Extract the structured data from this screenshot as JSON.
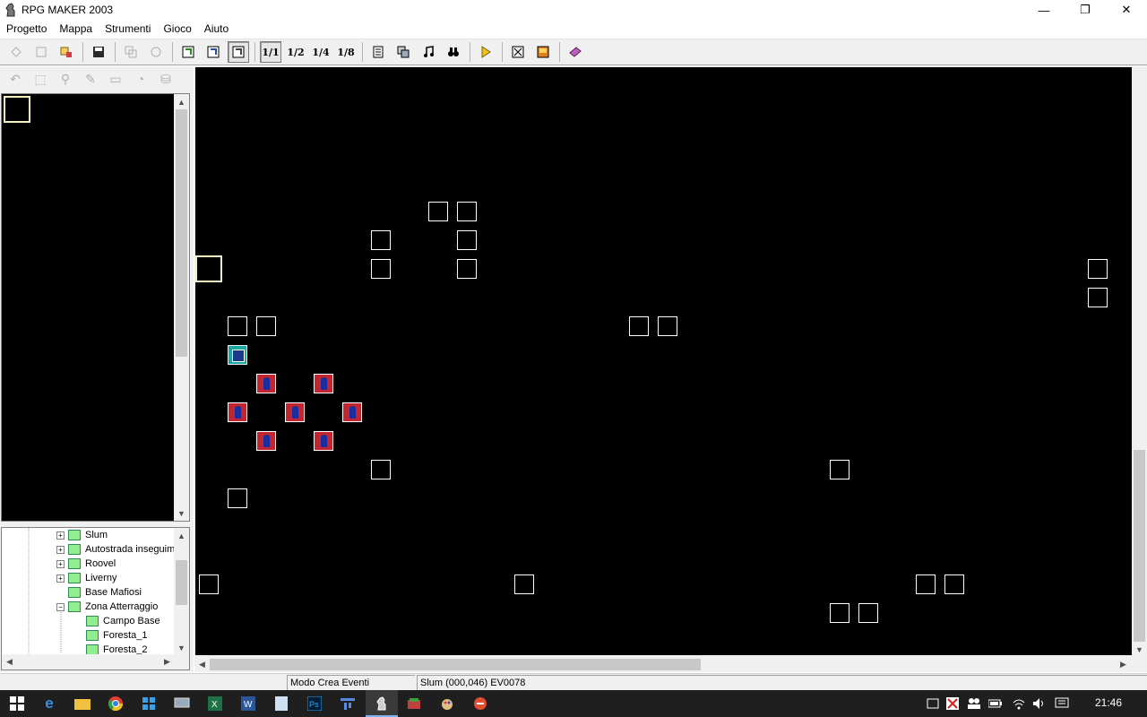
{
  "window": {
    "title": "RPG MAKER 2003",
    "minimize": "—",
    "restore": "❐",
    "close": "✕"
  },
  "menu": [
    "Progetto",
    "Mappa",
    "Strumenti",
    "Gioco",
    "Aiuto"
  ],
  "toolbar": {
    "zoom": [
      "1/1",
      "1/2",
      "1/4",
      "1/8"
    ],
    "zoom_labels": {
      "z1": "1",
      "z1d": "1",
      "z2": "1",
      "z2d": "2",
      "z4": "1",
      "z4d": "4",
      "z8": "1",
      "z8d": "8"
    }
  },
  "tree": {
    "items": [
      {
        "label": "Slum",
        "expander": "+"
      },
      {
        "label": "Autostrada inseguim",
        "expander": "+"
      },
      {
        "label": "Roovel",
        "expander": "+"
      },
      {
        "label": "Liverny",
        "expander": "+"
      },
      {
        "label": "Base Mafiosi",
        "expander": ""
      },
      {
        "label": "Zona Atterraggio",
        "expander": "−"
      },
      {
        "label": "Campo Base",
        "expander": ""
      },
      {
        "label": "Foresta_1",
        "expander": ""
      },
      {
        "label": "Foresta_2",
        "expander": ""
      }
    ]
  },
  "status": {
    "mode": "Modo Crea Eventi",
    "position": "Slum (000,046) EV0078"
  },
  "taskbar": {
    "clock": "21:46"
  },
  "colors": {
    "map_bg": "#000000",
    "event_border": "#ffffff",
    "selection": "#f4f0c0",
    "sprite_bg": "#c0262f",
    "taskbar": "#1f1f1f"
  }
}
